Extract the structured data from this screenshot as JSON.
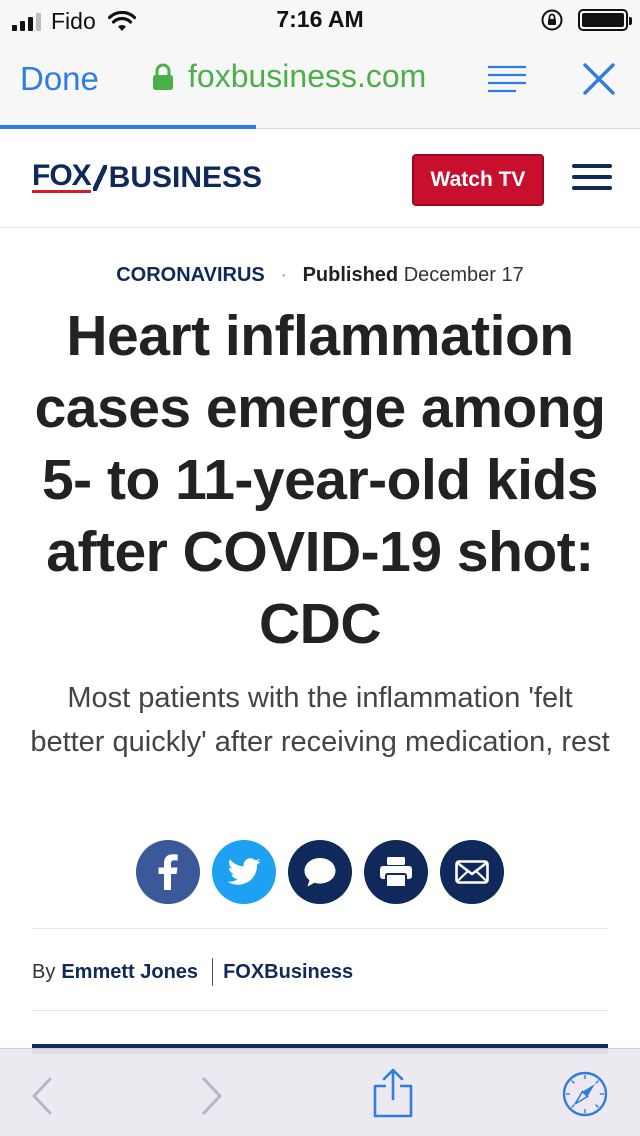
{
  "status_bar": {
    "carrier": "Fido",
    "time": "7:16 AM",
    "battery_level": 1.0
  },
  "browser": {
    "done_label": "Done",
    "url": "foxbusiness.com",
    "load_progress": 0.4,
    "colors": {
      "accent": "#2f7de1",
      "secure_url": "#4cb04a"
    }
  },
  "site": {
    "logo_fox": "FOX",
    "logo_business": "BUSINESS",
    "watch_tv_label": "Watch TV",
    "colors": {
      "brand_navy": "#0f2a5a",
      "brand_red": "#c8102e"
    }
  },
  "article": {
    "category": "CORONAVIRUS",
    "published_label": "Published",
    "published_date": "December 17",
    "headline": "Heart inflammation cases emerge among 5- to 11-year-old kids after COVID-19 shot: CDC",
    "dek": "Most patients with the inflammation 'felt better quickly' after receiving medication, rest",
    "byline_prefix": "By",
    "author": "Emmett Jones",
    "source": "FOXBusiness"
  },
  "share": {
    "buttons": [
      {
        "icon": "facebook-icon"
      },
      {
        "icon": "twitter-icon"
      },
      {
        "icon": "comment-icon"
      },
      {
        "icon": "print-icon"
      },
      {
        "icon": "email-icon"
      }
    ]
  },
  "toolbar": {
    "icons": [
      "back-arrow-icon",
      "forward-arrow-icon",
      "share-icon",
      "safari-compass-icon"
    ]
  }
}
